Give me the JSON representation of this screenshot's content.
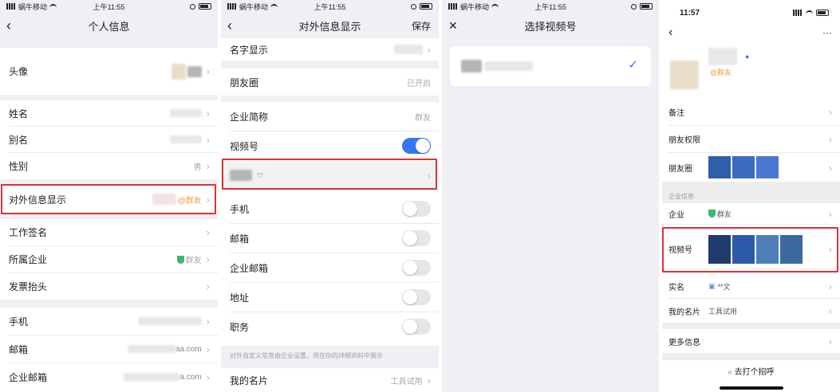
{
  "status": {
    "carrier": "蜗牛移动",
    "time": "上午11:55",
    "time_right": "11:57"
  },
  "screen1": {
    "title": "个人信息",
    "back": "‹",
    "rows": {
      "avatar": "头像",
      "name": "姓名",
      "alias": "别名",
      "gender": "性别",
      "gender_value": "男",
      "external": "对外信息显示",
      "external_value": "@群友",
      "work_sign": "工作签名",
      "company": "所属企业",
      "company_value": "群友",
      "invoice": "发票抬头",
      "phone": "手机",
      "email": "邮箱",
      "email_value": "aa.com",
      "corp_email": "企业邮箱",
      "corp_email_value": "a.com"
    }
  },
  "screen2": {
    "title": "对外信息显示",
    "save": "保存",
    "rows": {
      "name_display": "名字显示",
      "moments": "朋友圈",
      "moments_value": "已开启",
      "corp_short": "企业简称",
      "corp_short_value": "群友",
      "video": "视频号",
      "phone": "手机",
      "email": "邮箱",
      "corp_email": "企业邮箱",
      "address": "地址",
      "job": "职务",
      "note": "对外自定义信息由企业设置，将在你的详细资料中展示",
      "card": "我的名片",
      "card_value": "工具试用"
    },
    "toggles": {
      "video": true,
      "phone": false,
      "email": false,
      "corp_email": false,
      "address": false,
      "job": false
    }
  },
  "screen3": {
    "title": "选择视频号",
    "close": "✕"
  },
  "screen4": {
    "friend_tag": "@群友",
    "more": "···",
    "rows": {
      "remark": "备注",
      "perm": "朋友权限",
      "moments": "朋友圈",
      "section_corp": "企业信息",
      "corp": "企业",
      "corp_value": "群友",
      "video": "视频号",
      "real_name": "实名",
      "real_name_value": "**文",
      "card": "我的名片",
      "card_value": "工具试用",
      "more_info": "更多信息",
      "greet": "去打个招呼"
    }
  },
  "colors": {
    "accent": "#3477f5",
    "highlight": "#d93434",
    "badge": "#e5a23d",
    "verified": "#3cb96b"
  }
}
